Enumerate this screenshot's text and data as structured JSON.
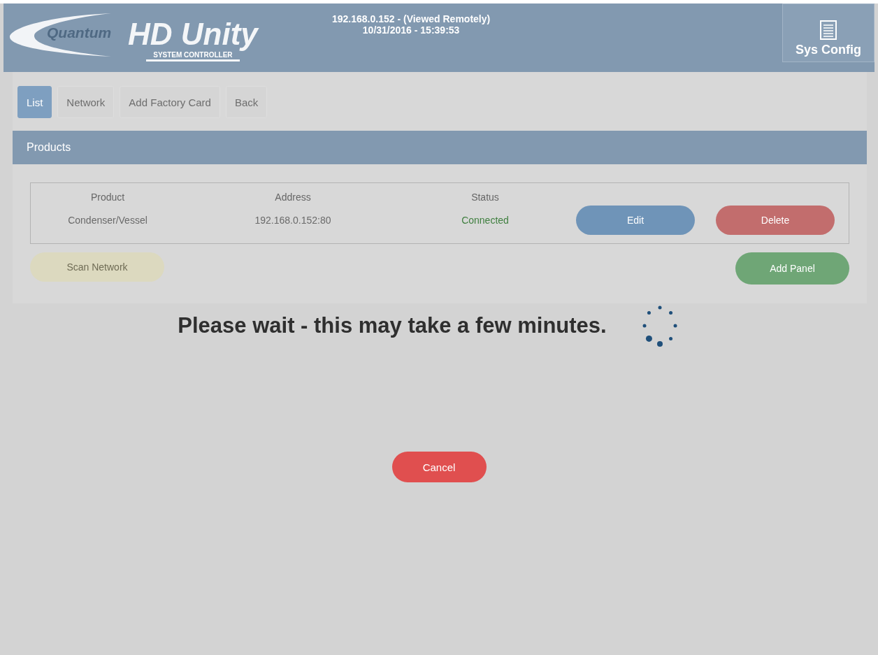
{
  "header": {
    "logo_brand": "Quantum",
    "logo_title": "HD Unity",
    "logo_subtitle": "SYSTEM CONTROLLER",
    "connection": "192.168.0.152 - (Viewed Remotely)",
    "datetime": "10/31/2016 - 15:39:53",
    "config_button": "Sys Config"
  },
  "tabs": [
    {
      "label": "List",
      "selected": true
    },
    {
      "label": "Network",
      "selected": false
    },
    {
      "label": "Add Factory Card",
      "selected": false
    },
    {
      "label": "Back",
      "selected": false
    }
  ],
  "panel": {
    "title": "Products",
    "columns": [
      "Product",
      "Address",
      "Status"
    ],
    "rows": [
      {
        "product": "Condenser/Vessel",
        "address": "192.168.0.152:80",
        "status": "Connected",
        "actions": [
          {
            "label": "Edit",
            "kind": "edit"
          },
          {
            "label": "Delete",
            "kind": "delete"
          }
        ]
      }
    ],
    "buttons": [
      {
        "label": "Scan Network",
        "kind": "scan"
      },
      {
        "label": "Add Panel",
        "kind": "add"
      }
    ]
  },
  "overlay": {
    "message": "Please wait - this may take a few minutes.",
    "cancel": "Cancel"
  }
}
